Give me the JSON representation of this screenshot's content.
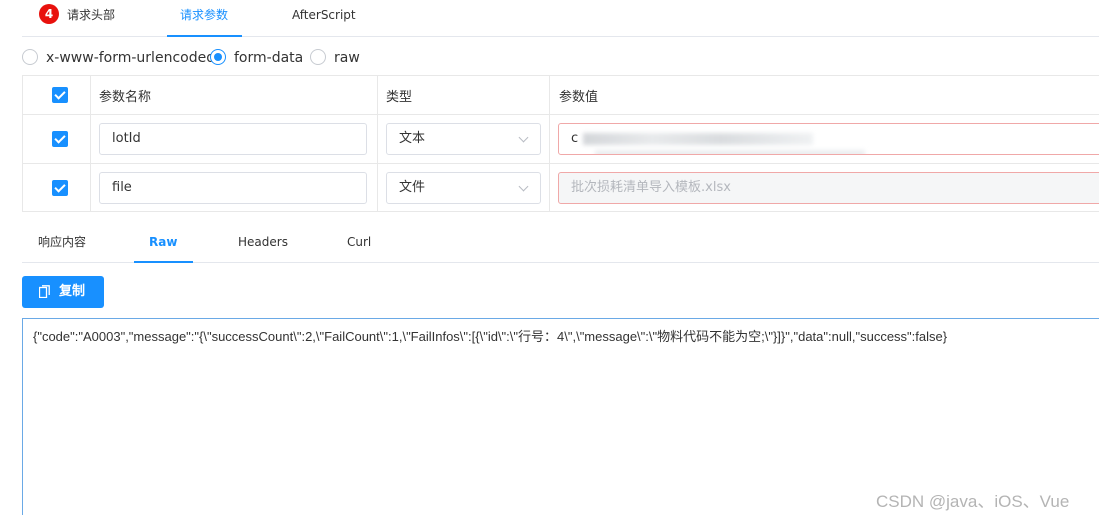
{
  "top_tabs": {
    "badge": "4",
    "headers": "请求头部",
    "params": "请求参数",
    "after_script": "AfterScript"
  },
  "body_types": {
    "urlencoded": "x-www-form-urlencoded",
    "form_data": "form-data",
    "raw": "raw",
    "selected": "form-data"
  },
  "param_table": {
    "columns": [
      "参数名称",
      "类型",
      "参数值"
    ],
    "rows": [
      {
        "checked": true,
        "name": "lotId",
        "type": "文本",
        "value": "c",
        "value_placeholder": ""
      },
      {
        "checked": true,
        "name": "file",
        "type": "文件",
        "value": "",
        "value_placeholder": "批次损耗清单导入模板.xlsx"
      }
    ]
  },
  "response_tabs": {
    "content": "响应内容",
    "raw": "Raw",
    "headers": "Headers",
    "curl": "Curl",
    "active": "Raw"
  },
  "copy_button": {
    "label": "复制",
    "icon": "copy-icon"
  },
  "raw_output": "{\"code\":\"A0003\",\"message\":\"{\\\"successCount\\\":2,\\\"FailCount\\\":1,\\\"FailInfos\\\":[{\\\"id\\\":\\\"行号：4\\\",\\\"message\\\":\\\"物料代码不能为空;\\\"}]}\",\"data\":null,\"success\":false}",
  "watermark": "CSDN @java、iOS、Vue",
  "colors": {
    "accent": "#1890ff",
    "badge": "#e8110d",
    "error_border": "#f0a8a8"
  }
}
